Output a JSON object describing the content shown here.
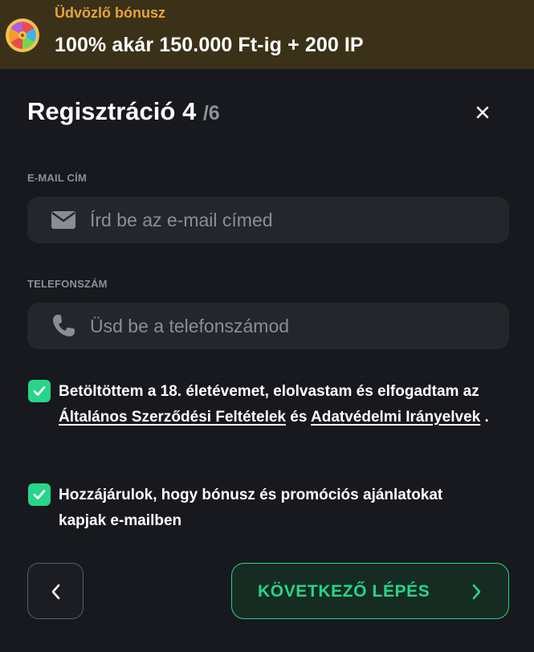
{
  "banner": {
    "kicker": "Üdvözlő bónusz",
    "headline": "100% akár 150.000 Ft-ig + 200 IP",
    "icon": "wheel-icon"
  },
  "modal": {
    "title": "Regisztráció 4",
    "step": "/6",
    "close_icon": "close-icon"
  },
  "form": {
    "email": {
      "label": "E-MAIL CÍM",
      "placeholder": "Írd be az e-mail címed",
      "value": "",
      "icon": "envelope-icon"
    },
    "phone": {
      "label": "TELEFONSZÁM",
      "placeholder": "Üsd be a telefonszámod",
      "value": "",
      "icon": "phone-icon"
    }
  },
  "consents": {
    "age": {
      "checked": true,
      "text_before": "Betöltöttem a 18. életévemet, elolvastam és elfogadtam az",
      "link1": "Általános Szerződési Feltételek",
      "middle": "és",
      "link2": "Adatvédelmi Irányelvek",
      "end": "."
    },
    "marketing": {
      "checked": true,
      "text": "Hozzájárulok, hogy bónusz és promóciós ajánlatokat kapjak e-mailben"
    }
  },
  "actions": {
    "next_label": "KÖVETKEZŐ LÉPÉS",
    "back_icon": "chevron-left-icon",
    "next_icon": "chevron-right-icon"
  },
  "colors": {
    "background": "#17191e",
    "banner": "#3a3118",
    "accent": "#27d58a",
    "banner_kicker": "#e6a23c",
    "field": "#24262c"
  }
}
